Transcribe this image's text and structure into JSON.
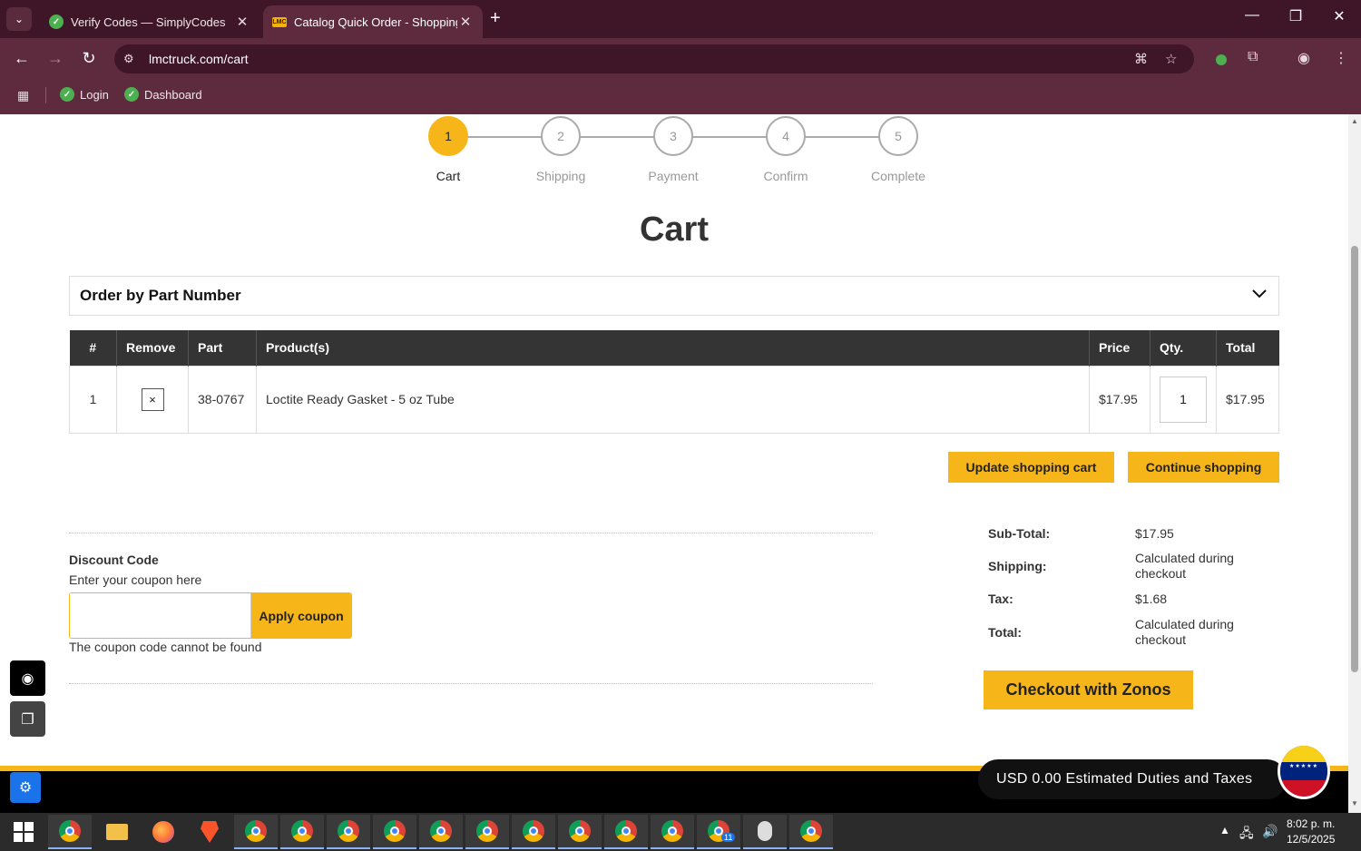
{
  "browser": {
    "tabs": [
      {
        "title": "Verify Codes — SimplyCodes",
        "icon": "simplycodes-icon",
        "active": false
      },
      {
        "title": "Catalog Quick Order - Shopping",
        "icon": "lmc-icon",
        "active": true
      }
    ],
    "url": "lmctruck.com/cart",
    "bookmarks": [
      {
        "label": "Login",
        "icon": "simplycodes-icon"
      },
      {
        "label": "Dashboard",
        "icon": "simplycodes-icon"
      }
    ]
  },
  "steps": [
    {
      "num": "1",
      "label": "Cart",
      "active": true
    },
    {
      "num": "2",
      "label": "Shipping",
      "active": false
    },
    {
      "num": "3",
      "label": "Payment",
      "active": false
    },
    {
      "num": "4",
      "label": "Confirm",
      "active": false
    },
    {
      "num": "5",
      "label": "Complete",
      "active": false
    }
  ],
  "page_title": "Cart",
  "order_by_part": {
    "label": "Order by Part Number"
  },
  "cart_table": {
    "headers": {
      "num": "#",
      "remove": "Remove",
      "part": "Part",
      "product": "Product(s)",
      "price": "Price",
      "qty": "Qty.",
      "total": "Total"
    },
    "rows": [
      {
        "num": "1",
        "remove_icon": "×",
        "part": "38-0767",
        "product": "Loctite Ready Gasket - 5 oz Tube",
        "price": "$17.95",
        "qty": "1",
        "total": "$17.95"
      }
    ]
  },
  "actions": {
    "update_cart": "Update shopping cart",
    "continue_shopping": "Continue shopping"
  },
  "discount": {
    "heading": "Discount Code",
    "subheading": "Enter your coupon here",
    "input_value": "",
    "button": "Apply coupon",
    "error": "The coupon code cannot be found"
  },
  "totals": {
    "subtotal_label": "Sub-Total:",
    "subtotal_value": "$17.95",
    "shipping_label": "Shipping:",
    "shipping_value": "Calculated during checkout",
    "tax_label": "Tax:",
    "tax_value": "$1.68",
    "total_label": "Total:",
    "total_value": "Calculated during checkout"
  },
  "checkout_button": "Checkout with Zonos",
  "duties_banner": "USD 0.00 Estimated Duties and Taxes",
  "taskbar": {
    "badge": "11",
    "time": "8:02 p. m.",
    "date": "12/5/2025"
  },
  "colors": {
    "accent": "#f6b619",
    "header_dark": "#343434",
    "browser_frame": "#5e2a3e"
  }
}
